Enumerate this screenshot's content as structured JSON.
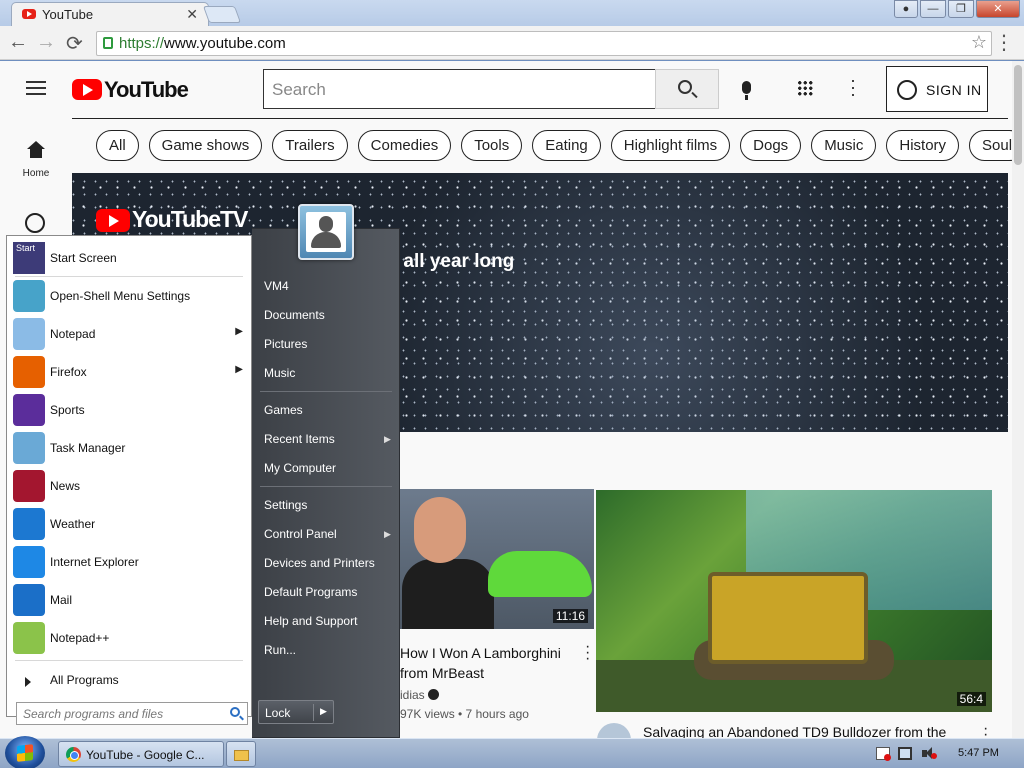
{
  "browser": {
    "tab_title": "YouTube",
    "tab_close": "✕",
    "url_scheme": "https://",
    "url_host": "www.youtube.com",
    "nav_back": "←",
    "nav_forward": "→",
    "nav_reload": "⟳",
    "bookmark_star": "☆",
    "menu": "⋮",
    "window_controls": {
      "minimize": "—",
      "maximize": "❐",
      "close": "✕"
    }
  },
  "youtube": {
    "brand": "YouTube",
    "search_placeholder": "Search",
    "sign_in": "SIGN IN",
    "sidebar_home": "Home",
    "chips": [
      "All",
      "Game shows",
      "Trailers",
      "Comedies",
      "Tools",
      "Eating",
      "Highlight films",
      "Dogs",
      "Music",
      "History",
      "Soul"
    ],
    "banner": {
      "logo_text": "YouTubeTV",
      "tagline": "ve all year long"
    },
    "videos": [
      {
        "title": "How I Won A Lamborghini from MrBeast",
        "channel": "idias",
        "meta": "97K views • 7 hours ago",
        "duration": "11:16"
      },
      {
        "title": "Salvaging an Abandoned TD9 Bulldozer from the",
        "duration": "56:4"
      }
    ]
  },
  "start_menu": {
    "programs": [
      {
        "label": "Start Screen",
        "color": "#3d3b78",
        "has_submenu": false
      },
      {
        "label": "Open-Shell Menu Settings",
        "color": "#47a3c9",
        "has_submenu": false
      },
      {
        "label": "Notepad",
        "color": "#8bbbe6",
        "has_submenu": true
      },
      {
        "label": "Firefox",
        "color": "#e66000",
        "has_submenu": true
      },
      {
        "label": "Sports",
        "color": "#5b2d9b",
        "has_submenu": false
      },
      {
        "label": "Task Manager",
        "color": "#6aa9d6",
        "has_submenu": false
      },
      {
        "label": "News",
        "color": "#a3162f",
        "has_submenu": false
      },
      {
        "label": "Weather",
        "color": "#1c78d1",
        "has_submenu": false
      },
      {
        "label": "Internet Explorer",
        "color": "#1e88e5",
        "has_submenu": false
      },
      {
        "label": "Mail",
        "color": "#1b6fc8",
        "has_submenu": false
      },
      {
        "label": "Notepad++",
        "color": "#8bc34a",
        "has_submenu": false
      }
    ],
    "start_tile_text": "Start",
    "all_programs": "All Programs",
    "search_placeholder": "Search programs and files",
    "right_items": [
      {
        "label": "VM4",
        "has_submenu": false
      },
      {
        "label": "Documents",
        "has_submenu": false
      },
      {
        "label": "Pictures",
        "has_submenu": false
      },
      {
        "label": "Music",
        "has_submenu": false
      },
      {
        "label": "Games",
        "has_submenu": false
      },
      {
        "label": "Recent Items",
        "has_submenu": true
      },
      {
        "label": "My Computer",
        "has_submenu": false
      },
      {
        "label": "Settings",
        "has_submenu": false
      },
      {
        "label": "Control Panel",
        "has_submenu": true
      },
      {
        "label": "Devices and Printers",
        "has_submenu": false
      },
      {
        "label": "Default Programs",
        "has_submenu": false
      },
      {
        "label": "Help and Support",
        "has_submenu": false
      },
      {
        "label": "Run...",
        "has_submenu": false
      }
    ],
    "lock_label": "Lock"
  },
  "taskbar": {
    "chrome_window": "YouTube - Google C...",
    "clock": "5:47 PM"
  }
}
